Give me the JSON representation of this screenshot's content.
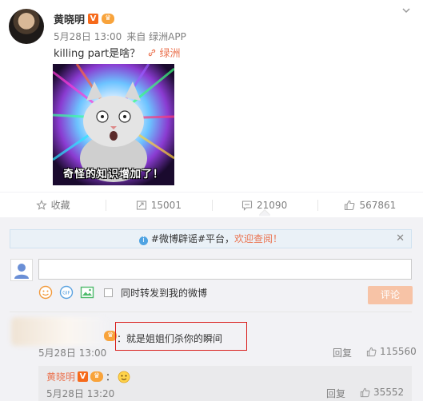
{
  "post": {
    "author": "黄晓明",
    "vip_badge": "V",
    "date": "5月28日 13:00",
    "source": "来自 绿洲APP",
    "text": "killing part是啥？",
    "link_text": "绿洲",
    "image_caption": "奇怪的知识增加了！"
  },
  "actions": {
    "favorite": "收藏",
    "repost": "15001",
    "comment": "21090",
    "like": "567861"
  },
  "comments": {
    "notice_before": "#微博辟谣#平台，",
    "notice_highlight": "欢迎查阅！",
    "repost_label": "同时转发到我的微博",
    "submit_label": "评论",
    "items": [
      {
        "text": "：就是姐姐们杀你的瞬间",
        "time": "5月28日 13:00",
        "reply_label": "回复",
        "likes": "115560"
      }
    ],
    "subreply": {
      "author": "黄晓明",
      "vip_badge": "V",
      "time": "5月28日 13:20",
      "reply_label": "回复",
      "likes": "35552"
    }
  },
  "colors": {
    "accent": "#eb7350",
    "muted": "#808080",
    "comment_bg": "#f2f2f5",
    "highlight_box": "#d9201e"
  }
}
